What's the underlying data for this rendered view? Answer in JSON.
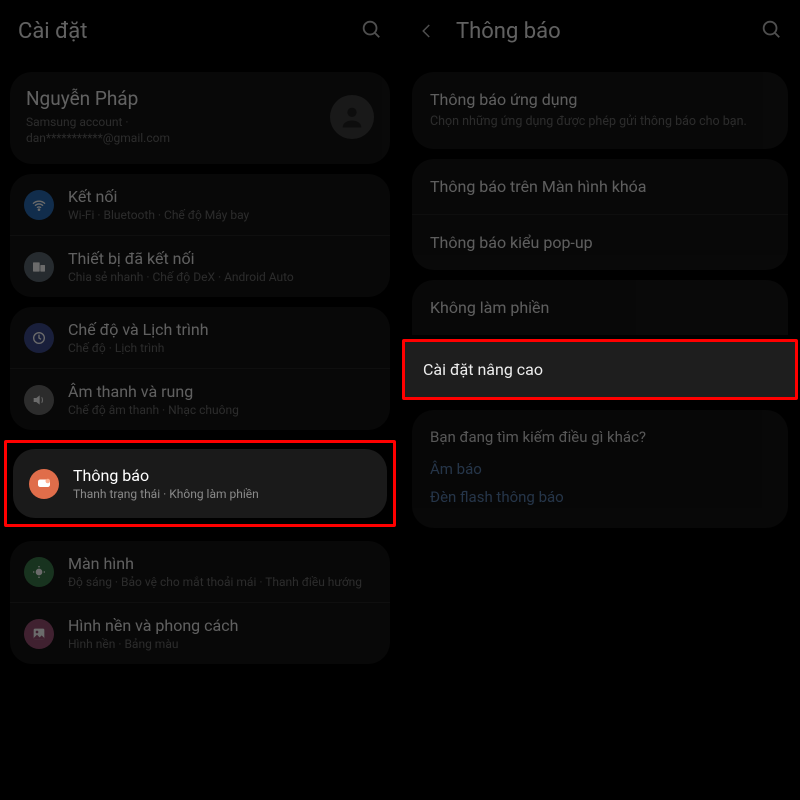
{
  "left": {
    "title": "Cài đặt",
    "profile": {
      "name": "Nguyễn Pháp",
      "account": "Samsung account  ·",
      "email": "dan***********@gmail.com"
    },
    "group1": [
      {
        "icon": "wifi",
        "title": "Kết nối",
        "sub": "Wi-Fi  ·  Bluetooth  ·  Chế độ Máy bay"
      },
      {
        "icon": "devices",
        "title": "Thiết bị đã kết nối",
        "sub": "Chia sẻ nhanh  ·  Chế độ DeX  ·  Android Auto"
      }
    ],
    "group2": [
      {
        "icon": "mode",
        "title": "Chế độ và Lịch trình",
        "sub": "Chế độ  ·  Lịch trình"
      },
      {
        "icon": "sound",
        "title": "Âm thanh và rung",
        "sub": "Chế độ âm thanh  ·  Nhạc chuông"
      }
    ],
    "notif": {
      "title": "Thông báo",
      "sub": "Thanh trạng thái  ·  Không làm phiền"
    },
    "group3": [
      {
        "icon": "display",
        "title": "Màn hình",
        "sub": "Độ sáng  ·  Bảo vệ cho mắt thoải mái  ·  Thanh điều hướng"
      },
      {
        "icon": "wallpaper",
        "title": "Hình nền và phong cách",
        "sub": "Hình nền  ·  Bảng màu"
      }
    ]
  },
  "right": {
    "title": "Thông báo",
    "group1": [
      {
        "title": "Thông báo ứng dụng",
        "sub": "Chọn những ứng dụng được phép gửi thông báo cho bạn."
      }
    ],
    "group2": [
      {
        "title": "Thông báo trên Màn hình khóa"
      },
      {
        "title": "Thông báo kiểu pop-up"
      }
    ],
    "group3": [
      {
        "title": "Không làm phiền"
      }
    ],
    "advanced": "Cài đặt nâng cao",
    "suggest": {
      "question": "Bạn đang tìm kiếm điều gì khác?",
      "link1": "Âm báo",
      "link2": "Đèn flash thông báo"
    }
  }
}
